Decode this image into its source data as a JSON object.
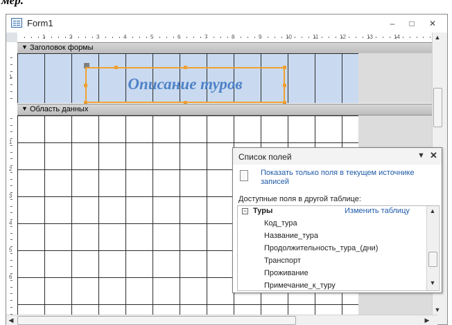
{
  "caption_fragment": "мер.",
  "window": {
    "title": "Form1",
    "controls": {
      "minimize": "–",
      "maximize": "□",
      "close": "✕"
    }
  },
  "ruler": {
    "horizontal": [
      "1",
      "2",
      "3",
      "4",
      "5",
      "6",
      "7",
      "8",
      "9",
      "10",
      "11",
      "12",
      "13",
      "14"
    ],
    "vertical": [
      "1",
      "2",
      "3",
      "4",
      "5",
      "6"
    ]
  },
  "sections": {
    "header": "Заголовок формы",
    "detail": "Область данных"
  },
  "label": {
    "caption": "Описание туров"
  },
  "field_list": {
    "title": "Список полей",
    "show_only_link": "Показать только поля в текущем источнике записей",
    "available_label": "Доступные поля в другой таблице:",
    "table_name": "Туры",
    "edit_table_link": "Изменить таблицу",
    "fields": [
      "Код_тура",
      "Название_тура",
      "Продолжительность_тура_(дни)",
      "Транспорт",
      "Проживание",
      "Примечание_к_туру"
    ]
  },
  "icons": [
    "form-icon",
    "minimize-icon",
    "maximize-icon",
    "close-icon",
    "section-arrow-icon",
    "dropdown-icon",
    "field-list-close-icon",
    "document-icon",
    "collapse-icon",
    "scroll-up-icon",
    "scroll-down-icon",
    "scroll-left-icon",
    "scroll-right-icon"
  ],
  "colors": {
    "label_border": "#f0a030",
    "label_text": "#4f82c7",
    "header_fill": "#c9daf0",
    "link": "#1e5aa8"
  }
}
